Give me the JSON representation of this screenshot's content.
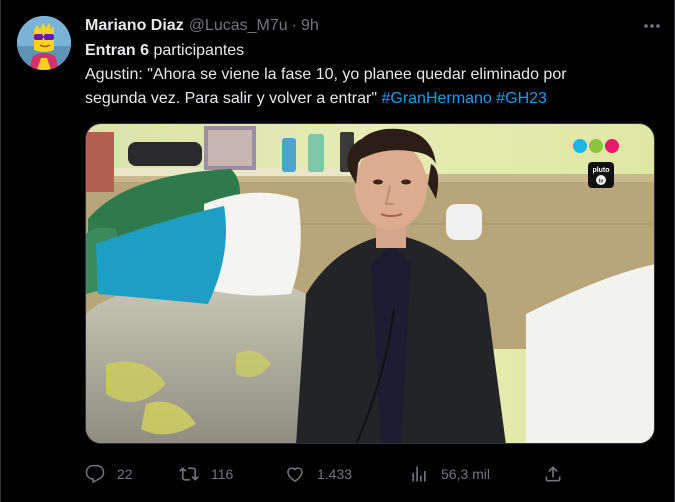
{
  "user": {
    "display_name": "Mariano Diaz",
    "handle": "@Lucas_M7u",
    "separator": "·",
    "time": "9h"
  },
  "tweet": {
    "line1_bold": "Entran 6",
    "line1_rest": " participantes",
    "line2": "Agustin: \"Ahora se viene la fase 10, yo planee quedar eliminado por",
    "line3": "segunda vez. Para salir y volver a entrar\" ",
    "hashtag1": "#GranHermano",
    "hashtag2": "#GH23"
  },
  "media": {
    "channel_badge": "pluto tv",
    "dot_colors": [
      "#1fb4e8",
      "#8bc53f",
      "#e6196f"
    ]
  },
  "actions": {
    "replies": "22",
    "retweets": "116",
    "likes": "1.433",
    "views": "56,3 mil"
  },
  "colors": {
    "background": "#000000",
    "text": "#e7e9ea",
    "muted": "#71767b",
    "link": "#1d9bf0"
  },
  "icons": [
    "more-icon",
    "reply-icon",
    "retweet-icon",
    "like-icon",
    "views-icon",
    "share-icon"
  ]
}
